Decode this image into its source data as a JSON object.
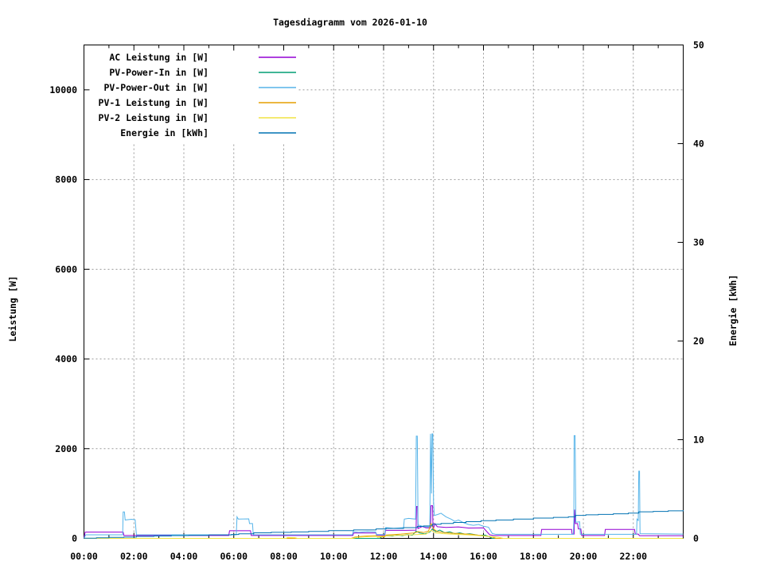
{
  "chart_data": {
    "type": "line",
    "title": "Tagesdiagramm vom 2026-01-10",
    "ylabel": "Leistung [W]",
    "y2label": "Energie [kWh]",
    "xlim": [
      0,
      24
    ],
    "ylim": [
      0,
      11000
    ],
    "y2lim": [
      0,
      50
    ],
    "grid": true,
    "legend_position": "top-left",
    "x_ticks": [
      {
        "hour": 0,
        "label": "00:00"
      },
      {
        "hour": 2,
        "label": "02:00"
      },
      {
        "hour": 4,
        "label": "04:00"
      },
      {
        "hour": 6,
        "label": "06:00"
      },
      {
        "hour": 8,
        "label": "08:00"
      },
      {
        "hour": 10,
        "label": "10:00"
      },
      {
        "hour": 12,
        "label": "12:00"
      },
      {
        "hour": 14,
        "label": "14:00"
      },
      {
        "hour": 16,
        "label": "16:00"
      },
      {
        "hour": 18,
        "label": "18:00"
      },
      {
        "hour": 20,
        "label": "20:00"
      },
      {
        "hour": 22,
        "label": "22:00"
      }
    ],
    "x_minor_hours": [
      1,
      3,
      5,
      7,
      9,
      11,
      13,
      15,
      17,
      19,
      21,
      23
    ],
    "grid_hours": [
      2,
      4,
      6,
      8,
      10,
      12,
      14,
      16,
      18,
      20,
      22,
      24
    ],
    "y_ticks": [
      {
        "value": 0,
        "label": "0"
      },
      {
        "value": 2000,
        "label": "2000"
      },
      {
        "value": 4000,
        "label": "4000"
      },
      {
        "value": 6000,
        "label": "6000"
      },
      {
        "value": 8000,
        "label": "8000"
      },
      {
        "value": 10000,
        "label": "10000"
      }
    ],
    "y2_ticks": [
      {
        "value": 0,
        "label": "0"
      },
      {
        "value": 10,
        "label": "10"
      },
      {
        "value": 20,
        "label": "20"
      },
      {
        "value": 30,
        "label": "30"
      },
      {
        "value": 40,
        "label": "40"
      },
      {
        "value": 50,
        "label": "50"
      }
    ],
    "series": [
      {
        "id": "ac",
        "name": "AC Leistung in [W]",
        "color": "#9400D3",
        "axis": "y1",
        "step": false,
        "points": [
          [
            0,
            0
          ],
          [
            0.05,
            140
          ],
          [
            1.57,
            140
          ],
          [
            1.6,
            65
          ],
          [
            5.8,
            65
          ],
          [
            5.83,
            170
          ],
          [
            6.67,
            170
          ],
          [
            6.7,
            65
          ],
          [
            10.77,
            65
          ],
          [
            10.8,
            120
          ],
          [
            11.7,
            120
          ],
          [
            11.72,
            70
          ],
          [
            12.05,
            70
          ],
          [
            12.08,
            180
          ],
          [
            12.85,
            180
          ],
          [
            13.3,
            185
          ],
          [
            13.32,
            710
          ],
          [
            13.36,
            710
          ],
          [
            13.38,
            220
          ],
          [
            13.55,
            265
          ],
          [
            13.7,
            235
          ],
          [
            13.88,
            235
          ],
          [
            13.9,
            730
          ],
          [
            13.96,
            730
          ],
          [
            13.98,
            180
          ],
          [
            14.05,
            330
          ],
          [
            14.15,
            260
          ],
          [
            14.5,
            245
          ],
          [
            15.0,
            255
          ],
          [
            15.4,
            230
          ],
          [
            16.0,
            235
          ],
          [
            16.25,
            80
          ],
          [
            16.4,
            65
          ],
          [
            18.3,
            65
          ],
          [
            18.33,
            200
          ],
          [
            19.53,
            200
          ],
          [
            19.55,
            95
          ],
          [
            19.63,
            95
          ],
          [
            19.65,
            640
          ],
          [
            19.68,
            330
          ],
          [
            19.77,
            330
          ],
          [
            19.8,
            210
          ],
          [
            19.9,
            210
          ],
          [
            19.93,
            65
          ],
          [
            20.85,
            65
          ],
          [
            20.88,
            200
          ],
          [
            22.05,
            200
          ],
          [
            22.08,
            95
          ],
          [
            22.2,
            95
          ],
          [
            22.25,
            60
          ],
          [
            24,
            60
          ]
        ]
      },
      {
        "id": "pv_in",
        "name": "PV-Power-In in [W]",
        "color": "#009E73",
        "axis": "y1",
        "step": false,
        "points": [
          [
            0,
            0
          ],
          [
            11.85,
            0
          ],
          [
            11.95,
            45
          ],
          [
            12.15,
            60
          ],
          [
            12.35,
            50
          ],
          [
            12.55,
            75
          ],
          [
            12.75,
            60
          ],
          [
            12.95,
            85
          ],
          [
            13.15,
            70
          ],
          [
            13.3,
            160
          ],
          [
            13.45,
            120
          ],
          [
            13.65,
            100
          ],
          [
            13.85,
            140
          ],
          [
            13.95,
            210
          ],
          [
            14.1,
            150
          ],
          [
            14.25,
            185
          ],
          [
            14.45,
            125
          ],
          [
            14.65,
            145
          ],
          [
            14.85,
            105
          ],
          [
            15.05,
            125
          ],
          [
            15.25,
            95
          ],
          [
            15.45,
            105
          ],
          [
            15.65,
            85
          ],
          [
            15.85,
            65
          ],
          [
            16.05,
            75
          ],
          [
            16.2,
            45
          ],
          [
            16.35,
            0
          ],
          [
            24,
            0
          ]
        ]
      },
      {
        "id": "pv_out",
        "name": "PV-Power-Out in [W]",
        "color": "#56B4E9",
        "axis": "y1",
        "step": false,
        "points": [
          [
            0,
            0
          ],
          [
            0.07,
            80
          ],
          [
            1.55,
            80
          ],
          [
            1.57,
            590
          ],
          [
            1.62,
            590
          ],
          [
            1.65,
            410
          ],
          [
            1.9,
            425
          ],
          [
            2.05,
            415
          ],
          [
            2.1,
            80
          ],
          [
            6.1,
            80
          ],
          [
            6.13,
            480
          ],
          [
            6.18,
            430
          ],
          [
            6.6,
            435
          ],
          [
            6.63,
            330
          ],
          [
            6.75,
            330
          ],
          [
            6.78,
            80
          ],
          [
            10.75,
            80
          ],
          [
            10.78,
            150
          ],
          [
            11.0,
            135
          ],
          [
            11.35,
            150
          ],
          [
            11.68,
            145
          ],
          [
            11.71,
            85
          ],
          [
            12.05,
            85
          ],
          [
            12.08,
            240
          ],
          [
            12.4,
            225
          ],
          [
            12.8,
            240
          ],
          [
            12.83,
            430
          ],
          [
            13.0,
            445
          ],
          [
            13.28,
            430
          ],
          [
            13.31,
            2280
          ],
          [
            13.35,
            2280
          ],
          [
            13.38,
            300
          ],
          [
            13.5,
            280
          ],
          [
            13.65,
            260
          ],
          [
            13.85,
            255
          ],
          [
            13.88,
            2330
          ],
          [
            13.92,
            1000
          ],
          [
            13.94,
            2330
          ],
          [
            13.97,
            2330
          ],
          [
            14.0,
            830
          ],
          [
            14.03,
            510
          ],
          [
            14.15,
            530
          ],
          [
            14.3,
            560
          ],
          [
            14.5,
            480
          ],
          [
            14.7,
            430
          ],
          [
            14.85,
            380
          ],
          [
            15.0,
            410
          ],
          [
            15.2,
            350
          ],
          [
            15.4,
            310
          ],
          [
            15.6,
            290
          ],
          [
            15.8,
            310
          ],
          [
            16.0,
            270
          ],
          [
            16.2,
            250
          ],
          [
            16.35,
            110
          ],
          [
            16.5,
            90
          ],
          [
            19.6,
            90
          ],
          [
            19.62,
            420
          ],
          [
            19.63,
            2290
          ],
          [
            19.67,
            2290
          ],
          [
            19.7,
            360
          ],
          [
            19.85,
            370
          ],
          [
            19.88,
            90
          ],
          [
            22.13,
            90
          ],
          [
            22.15,
            430
          ],
          [
            22.2,
            400
          ],
          [
            22.22,
            1500
          ],
          [
            22.25,
            1500
          ],
          [
            22.27,
            105
          ],
          [
            24,
            95
          ]
        ]
      },
      {
        "id": "pv1",
        "name": "PV-1 Leistung in [W]",
        "color": "#E69F00",
        "axis": "y1",
        "step": false,
        "points": [
          [
            0,
            0
          ],
          [
            10.7,
            0
          ],
          [
            10.85,
            30
          ],
          [
            11.1,
            45
          ],
          [
            11.4,
            55
          ],
          [
            11.7,
            60
          ],
          [
            11.75,
            30
          ],
          [
            12.05,
            35
          ],
          [
            12.1,
            75
          ],
          [
            12.4,
            85
          ],
          [
            12.7,
            95
          ],
          [
            13.0,
            110
          ],
          [
            13.2,
            120
          ],
          [
            13.4,
            150
          ],
          [
            13.6,
            130
          ],
          [
            13.8,
            165
          ],
          [
            13.9,
            330
          ],
          [
            14.0,
            210
          ],
          [
            14.15,
            150
          ],
          [
            14.35,
            135
          ],
          [
            14.6,
            120
          ],
          [
            14.9,
            110
          ],
          [
            15.2,
            100
          ],
          [
            15.5,
            90
          ],
          [
            15.8,
            70
          ],
          [
            16.1,
            50
          ],
          [
            16.35,
            30
          ],
          [
            16.5,
            0
          ],
          [
            24,
            0
          ]
        ]
      },
      {
        "id": "pv2",
        "name": "PV-2 Leistung in [W]",
        "color": "#F0E442",
        "axis": "y1",
        "step": false,
        "points": [
          [
            0,
            0
          ],
          [
            8.1,
            0
          ],
          [
            8.15,
            20
          ],
          [
            8.45,
            15
          ],
          [
            8.55,
            0
          ],
          [
            10.75,
            0
          ],
          [
            10.95,
            25
          ],
          [
            11.3,
            35
          ],
          [
            11.7,
            45
          ],
          [
            12.1,
            55
          ],
          [
            12.5,
            65
          ],
          [
            12.9,
            75
          ],
          [
            13.3,
            85
          ],
          [
            13.7,
            95
          ],
          [
            13.9,
            180
          ],
          [
            14.1,
            120
          ],
          [
            14.4,
            105
          ],
          [
            14.7,
            95
          ],
          [
            15.0,
            88
          ],
          [
            15.4,
            78
          ],
          [
            15.8,
            62
          ],
          [
            16.2,
            45
          ],
          [
            16.6,
            25
          ],
          [
            16.8,
            0
          ],
          [
            24,
            0
          ]
        ]
      },
      {
        "id": "energie",
        "name": "Energie in [kWh]",
        "color": "#0072B2",
        "axis": "y2",
        "step": true,
        "points": [
          [
            0,
            0.02
          ],
          [
            0.5,
            0.06
          ],
          [
            1.0,
            0.1
          ],
          [
            1.6,
            0.13
          ],
          [
            2.1,
            0.2
          ],
          [
            2.8,
            0.24
          ],
          [
            3.5,
            0.28
          ],
          [
            4.2,
            0.31
          ],
          [
            5.0,
            0.35
          ],
          [
            5.9,
            0.39
          ],
          [
            6.2,
            0.46
          ],
          [
            6.8,
            0.56
          ],
          [
            7.5,
            0.61
          ],
          [
            8.3,
            0.66
          ],
          [
            9.0,
            0.71
          ],
          [
            9.8,
            0.79
          ],
          [
            10.8,
            0.86
          ],
          [
            11.7,
            0.96
          ],
          [
            12.1,
            1.01
          ],
          [
            12.8,
            1.09
          ],
          [
            13.35,
            1.21
          ],
          [
            13.6,
            1.26
          ],
          [
            13.95,
            1.43
          ],
          [
            14.3,
            1.51
          ],
          [
            14.8,
            1.61
          ],
          [
            15.3,
            1.69
          ],
          [
            15.9,
            1.79
          ],
          [
            16.5,
            1.86
          ],
          [
            17.2,
            1.96
          ],
          [
            18.0,
            2.06
          ],
          [
            18.8,
            2.13
          ],
          [
            19.4,
            2.19
          ],
          [
            19.68,
            2.33
          ],
          [
            20.1,
            2.39
          ],
          [
            20.6,
            2.43
          ],
          [
            21.2,
            2.49
          ],
          [
            21.8,
            2.56
          ],
          [
            22.22,
            2.69
          ],
          [
            22.8,
            2.73
          ],
          [
            23.4,
            2.79
          ],
          [
            24,
            2.85
          ]
        ]
      }
    ]
  }
}
